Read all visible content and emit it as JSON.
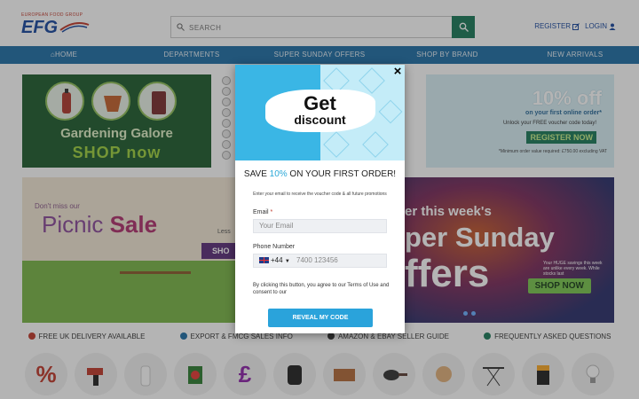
{
  "header": {
    "logo_tagline": "EUROPEAN FOOD GROUP",
    "logo_text": "EFG",
    "search_placeholder": "SEARCH",
    "register_label": "REGISTER",
    "login_label": "LOGIN"
  },
  "nav": {
    "items": [
      "HOME",
      "DEPARTMENTS",
      "SUPER SUNDAY OFFERS",
      "SHOP BY BRAND",
      "NEW ARRIVALS"
    ]
  },
  "banners": {
    "garden": {
      "title": "Gardening Galore",
      "cta": "SHOP now"
    },
    "discount": {
      "big": "10% off",
      "sub": "on your first online order*",
      "code": "Unlock your FREE voucher code today!",
      "cta": "REGISTER NOW",
      "note": "*Minimum order value required: £750.00 excluding VAT"
    },
    "picnic": {
      "small": "Don't miss our",
      "title_plain": "Picnic ",
      "title_bold": "Sale",
      "partial_text": "Less",
      "partial_cta": "SHO"
    },
    "super": {
      "line1": "er this week's",
      "line2": "per Sunday",
      "line3": "ffers",
      "note": "Your HUGE savings this week are unlike every week. While stocks last",
      "cta": "SHOP NOW"
    }
  },
  "info_strip": [
    {
      "label": "FREE UK DELIVERY AVAILABLE",
      "color": "#c0392b"
    },
    {
      "label": "EXPORT & FMCG SALES INFO",
      "color": "#1f6fa6"
    },
    {
      "label": "AMAZON & EBAY SELLER GUIDE",
      "color": "#333333"
    },
    {
      "label": "FREQUENTLY ASKED QUESTIONS",
      "color": "#1b7a5a"
    }
  ],
  "categories": [
    "%",
    "drill",
    "dove",
    "persil",
    "£",
    "airfryer",
    "box",
    "pan",
    "cats",
    "ironing-board",
    "batteries",
    "bulb"
  ],
  "modal": {
    "hero_get": "Get",
    "hero_discount": "discount",
    "close_label": "×",
    "headline_pre": "SAVE ",
    "headline_pct": "10%",
    "headline_post": " ON YOUR FIRST ORDER!",
    "subtext": "Enter your email to receive the voucher code & all future promotions",
    "email_label": "Email",
    "email_required": "*",
    "email_placeholder": "Your Email",
    "phone_label": "Phone Number",
    "phone_code": "+44",
    "phone_placeholder": "7400 123456",
    "terms": "By clicking this button, you agree to our Terms of Use and consent to our",
    "button_label": "REVEAL MY CODE"
  },
  "colors": {
    "brand_blue": "#17479e",
    "nav_blue": "#1f6fa6",
    "accent_green": "#1b7a5a",
    "modal_cta": "#2aa3db"
  }
}
